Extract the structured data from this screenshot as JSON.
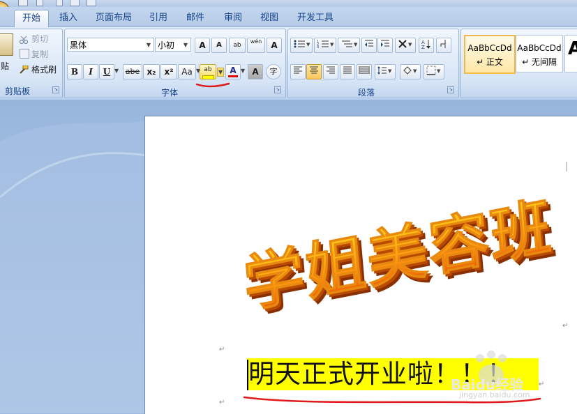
{
  "tabs": [
    "开始",
    "插入",
    "页面布局",
    "引用",
    "邮件",
    "审阅",
    "视图",
    "开发工具"
  ],
  "active_tab": "开始",
  "clipboard": {
    "paste_label": "贴",
    "cut_label": "剪切",
    "copy_label": "复制",
    "format_painter_label": "格式刷",
    "group_label": "剪贴板"
  },
  "font": {
    "name": "黑体",
    "size": "小初",
    "grow_label": "A",
    "shrink_label": "A",
    "clear_label": "ab",
    "phonetic_label": "wén",
    "border_label": "A",
    "bold_label": "B",
    "italic_label": "I",
    "underline_label": "U",
    "strike_label": "abe",
    "sub_label": "x₂",
    "sup_label": "x²",
    "case_label": "Aa",
    "highlight_label": "ab",
    "font_color_label": "A",
    "shading_label": "A",
    "enclose_label": "字",
    "group_label": "字体",
    "highlight_color": "#ffff00",
    "font_color": "#e00000"
  },
  "paragraph": {
    "group_label": "段落"
  },
  "styles": [
    {
      "sample": "AaBbCcDd",
      "name": "↵ 正文"
    },
    {
      "sample": "AaBbCcDd",
      "name": "↵ 无间隔"
    },
    {
      "sample": "A",
      "name": ""
    }
  ],
  "document": {
    "wordart_text": "学姐美容班",
    "line2_text": "明天正式开业啦！！！",
    "para_mark": "↵"
  },
  "watermark": {
    "brand": "Baidu经验",
    "url": "jingyan.baidu.com"
  }
}
